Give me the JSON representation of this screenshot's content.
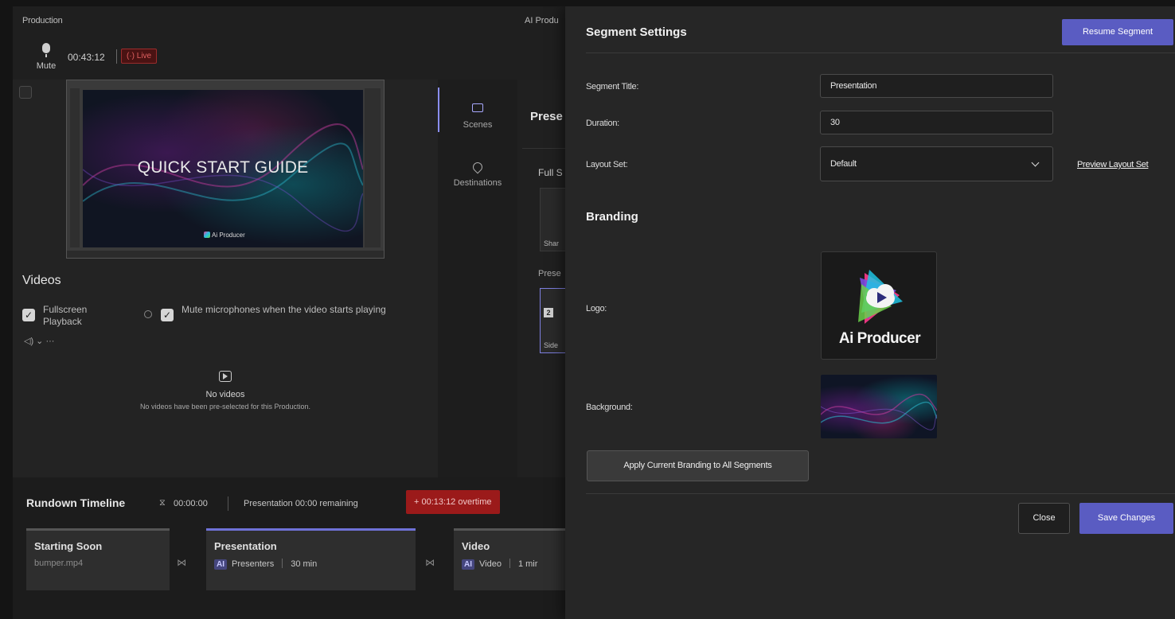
{
  "app": {
    "title": "Production",
    "title_right": "AI Produ"
  },
  "header": {
    "mute_label": "Mute",
    "elapsed": "00:43:12",
    "live_label": "(·) Live"
  },
  "preview": {
    "slide_title": "QUICK START GUIDE",
    "slide_logo": "Ai Producer"
  },
  "videos": {
    "heading": "Videos",
    "fullscreen_label": "Fullscreen Playback",
    "mute_mics_label": "Mute microphones when the video starts playing",
    "volume_label": "◁) ⌄   ···",
    "empty_title": "No videos",
    "empty_desc": "No videos have been pre-selected for this Production."
  },
  "nav": {
    "scenes": "Scenes",
    "destinations": "Destinations"
  },
  "scenes": {
    "title": "Prese",
    "full_section": "Full S",
    "thumb_a_caption": "Shar",
    "pres_section": "Prese",
    "thumb_b_num": "2",
    "thumb_b_caption": "Side"
  },
  "timeline": {
    "heading": "Rundown Timeline",
    "hourglass_icon": "⧖",
    "elapsed": "00:00:00",
    "remaining": "Presentation 00:00 remaining",
    "overtime": "+ 00:13:12 overtime",
    "transition_icon": "⋈",
    "segments": [
      {
        "name": "Starting Soon",
        "sub": "bumper.mp4"
      },
      {
        "name": "Presentation",
        "badge": "AI",
        "type": "Presenters",
        "duration": "30 min"
      },
      {
        "name": "Video",
        "badge": "AI",
        "type": "Video",
        "duration": "1 mir"
      }
    ]
  },
  "panel": {
    "title": "Segment Settings",
    "resume_button": "Resume Segment",
    "segment_title_label": "Segment Title:",
    "segment_title_value": "Presentation",
    "duration_label": "Duration:",
    "duration_value": "30",
    "layout_set_label": "Layout Set:",
    "layout_set_value": "Default",
    "preview_layout_link": "Preview Layout Set",
    "branding_heading": "Branding",
    "logo_label": "Logo:",
    "logo_text": "Ai Producer",
    "background_label": "Background:",
    "apply_button": "Apply Current Branding to All Segments",
    "close_button": "Close",
    "save_button": "Save Changes"
  },
  "colors": {
    "accent": "#5a5cc2",
    "live": "#e06060",
    "overtime": "#9b1a1a",
    "panel_bg": "#262626"
  }
}
